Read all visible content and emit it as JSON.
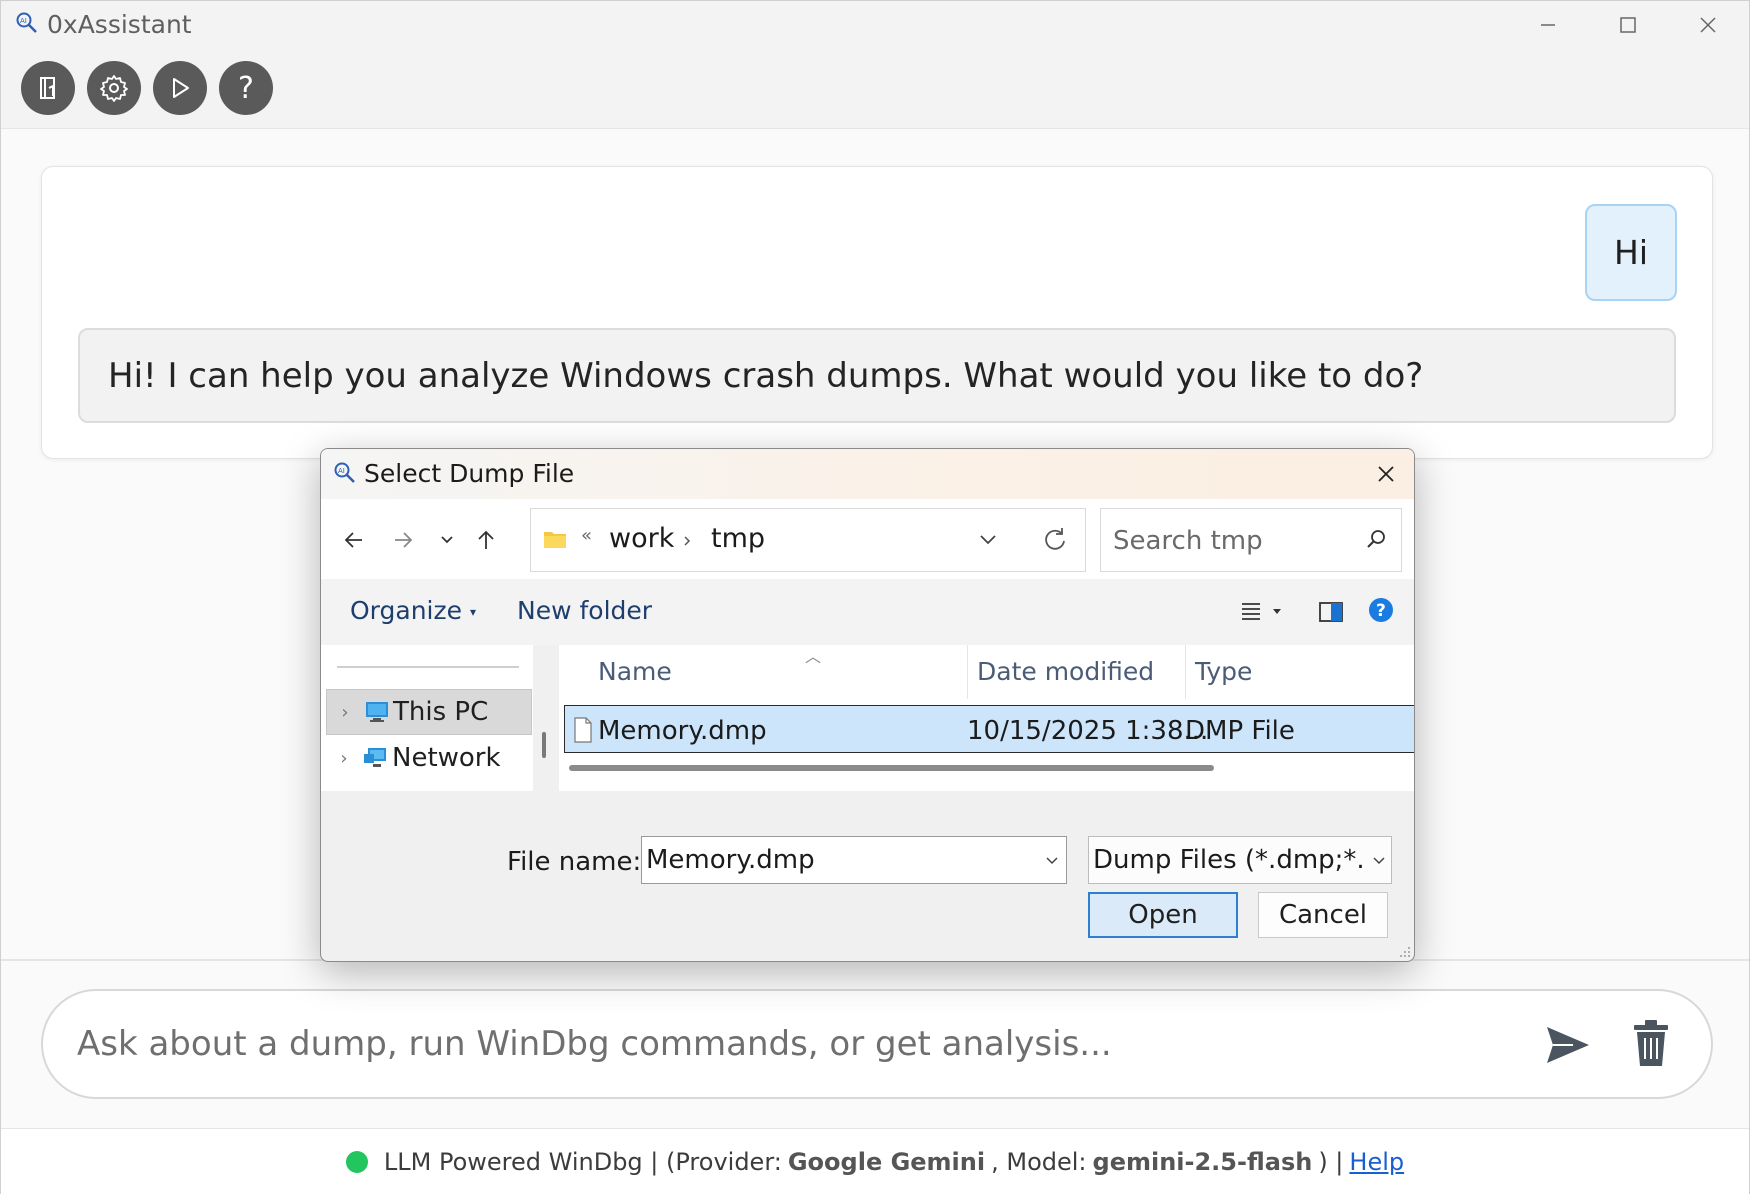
{
  "app": {
    "title": "0xAssistant"
  },
  "toolbar": {
    "buttons": [
      {
        "name": "open-dump",
        "icon": "book-icon"
      },
      {
        "name": "settings",
        "icon": "gear-icon"
      },
      {
        "name": "run",
        "icon": "play-icon"
      },
      {
        "name": "help",
        "icon": "question-icon",
        "glyph": "?"
      }
    ]
  },
  "chat": {
    "messages": [
      {
        "role": "user",
        "text": "Hi"
      },
      {
        "role": "assistant",
        "text": "Hi! I can help you analyze Windows crash dumps. What would you like to do?"
      }
    ]
  },
  "input": {
    "placeholder": "Ask about a dump, run WinDbg commands, or get analysis..."
  },
  "status": {
    "indicator_color": "#22c55e",
    "prefix": "LLM Powered WinDbg | (Provider:",
    "provider": "Google Gemini",
    "model_label": ", Model:",
    "model": "gemini-2.5-flash",
    "suffix": ") |",
    "help_link": "Help"
  },
  "dialog": {
    "title": "Select Dump File",
    "breadcrumb": {
      "overflow": "«",
      "items": [
        "work",
        "tmp"
      ]
    },
    "search_placeholder": "Search tmp",
    "commands": {
      "organize": "Organize",
      "new_folder": "New folder"
    },
    "nav_tree": [
      {
        "label": "This PC",
        "icon": "computer-icon",
        "selected": true
      },
      {
        "label": "Network",
        "icon": "network-icon",
        "selected": false
      }
    ],
    "columns": [
      "Name",
      "Date modified",
      "Type"
    ],
    "files": [
      {
        "name": "Memory.dmp",
        "date_modified": "10/15/2025 1:38...",
        "type": "DMP File",
        "selected": true
      }
    ],
    "file_name_label": "File name:",
    "file_name_value": "Memory.dmp",
    "file_type_value": "Dump Files (*.dmp;*.mdmp)",
    "open_label": "Open",
    "cancel_label": "Cancel"
  },
  "colors": {
    "accent": "#2f7fd0",
    "selection": "#cce5fb",
    "toolbar_button": "#5a5a5a"
  }
}
